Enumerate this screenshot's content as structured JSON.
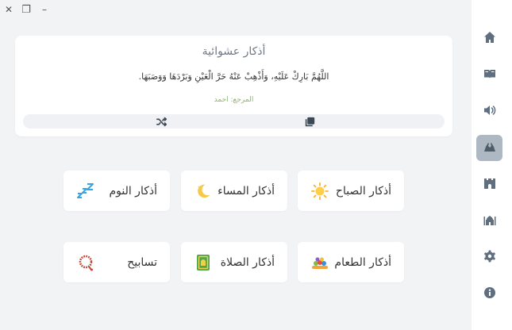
{
  "window": {
    "close_glyph": "✕",
    "restore_glyph": "❐",
    "minimize_glyph": "–"
  },
  "card": {
    "title": "أذكار عشوائية",
    "text": "اللَّهُمَّ بَارِكْ عَلَيْهِ، وَأَذْهِبْ عَنْهُ حَرَّ الْعَيْنِ وَبَرْدَهَا وَوَصَبَهَا.",
    "reference": "المرجع: احمد",
    "icons": [
      "shuffle-icon",
      "copy-icon"
    ]
  },
  "tiles": [
    {
      "label": "أذكار الصباح",
      "icon": "sun-icon"
    },
    {
      "label": "أذكار المساء",
      "icon": "moon-icon"
    },
    {
      "label": "أذكار النوم",
      "icon": "sleep-icon"
    },
    {
      "label": "أذكار الطعام",
      "icon": "food-icon"
    },
    {
      "label": "أذكار الصلاة",
      "icon": "prayer-mat-icon"
    },
    {
      "label": "تسابيح",
      "icon": "tasbih-icon"
    }
  ],
  "sidebar": {
    "items": [
      {
        "icon": "home-icon",
        "active": false
      },
      {
        "icon": "quran-icon",
        "active": false
      },
      {
        "icon": "speaker-icon",
        "active": false
      },
      {
        "icon": "praying-hands-icon",
        "active": true
      },
      {
        "icon": "castle-icon",
        "active": false
      },
      {
        "icon": "mosque-icon",
        "active": false
      },
      {
        "icon": "settings-icon",
        "active": false
      },
      {
        "icon": "info-icon",
        "active": false
      }
    ]
  },
  "colors": {
    "background": "#f2f3f5",
    "sidebar_active": "#aeb8c3",
    "icon": "#5f6f7f",
    "reference_green": "#8bb86b"
  }
}
